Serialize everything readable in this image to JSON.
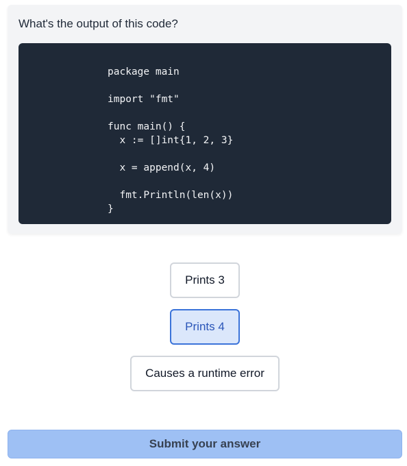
{
  "question": {
    "prompt": "What's the output of this code?",
    "code": "package main\n\nimport \"fmt\"\n\nfunc main() {\n  x := []int{1, 2, 3}\n\n  x = append(x, 4)\n\n  fmt.Println(len(x))\n}"
  },
  "options": [
    {
      "label": "Prints 3",
      "selected": false
    },
    {
      "label": "Prints 4",
      "selected": true
    },
    {
      "label": "Causes a runtime error",
      "selected": false
    }
  ],
  "submit": {
    "label": "Submit your answer"
  },
  "colors": {
    "selected_border": "#3b73d9",
    "selected_background": "#dbe7fb",
    "submit_background": "#9ec0f4",
    "code_background": "#1f2937"
  }
}
